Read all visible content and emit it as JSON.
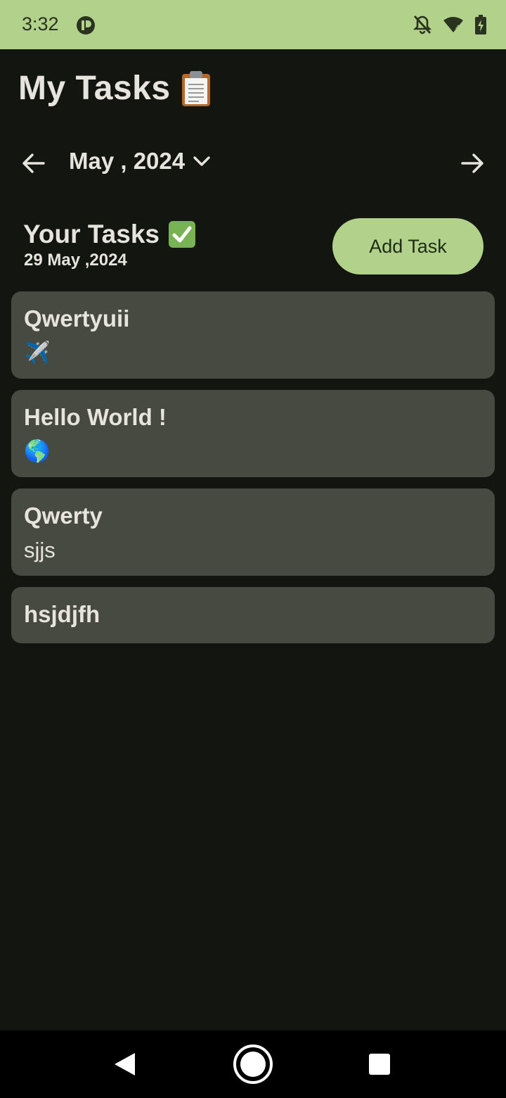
{
  "status_bar": {
    "time": "3:32",
    "icons": [
      "app-notification-icon",
      "bell-off-icon",
      "wifi-icon",
      "battery-charging-icon"
    ]
  },
  "header": {
    "title": "My Tasks",
    "title_icon": "clipboard-icon"
  },
  "month_selector": {
    "label": "May , 2024",
    "prev_icon": "arrow-left-icon",
    "next_icon": "arrow-right-icon",
    "dropdown_icon": "chevron-down-icon"
  },
  "tasks_section": {
    "heading": "Your Tasks",
    "heading_icon": "check-box-icon",
    "date": "29 May ,2024",
    "add_button_label": "Add Task"
  },
  "tasks": [
    {
      "title": "Qwertyuii",
      "description": "✈️"
    },
    {
      "title": "Hello World !",
      "description": "🌎"
    },
    {
      "title": "Qwerty",
      "description": "sjjs"
    },
    {
      "title": "hsjdjfh",
      "description": ""
    }
  ],
  "colors": {
    "accent": "#b2d18b",
    "background": "#131510",
    "card": "#474a41",
    "text": "#e6e4dc"
  }
}
